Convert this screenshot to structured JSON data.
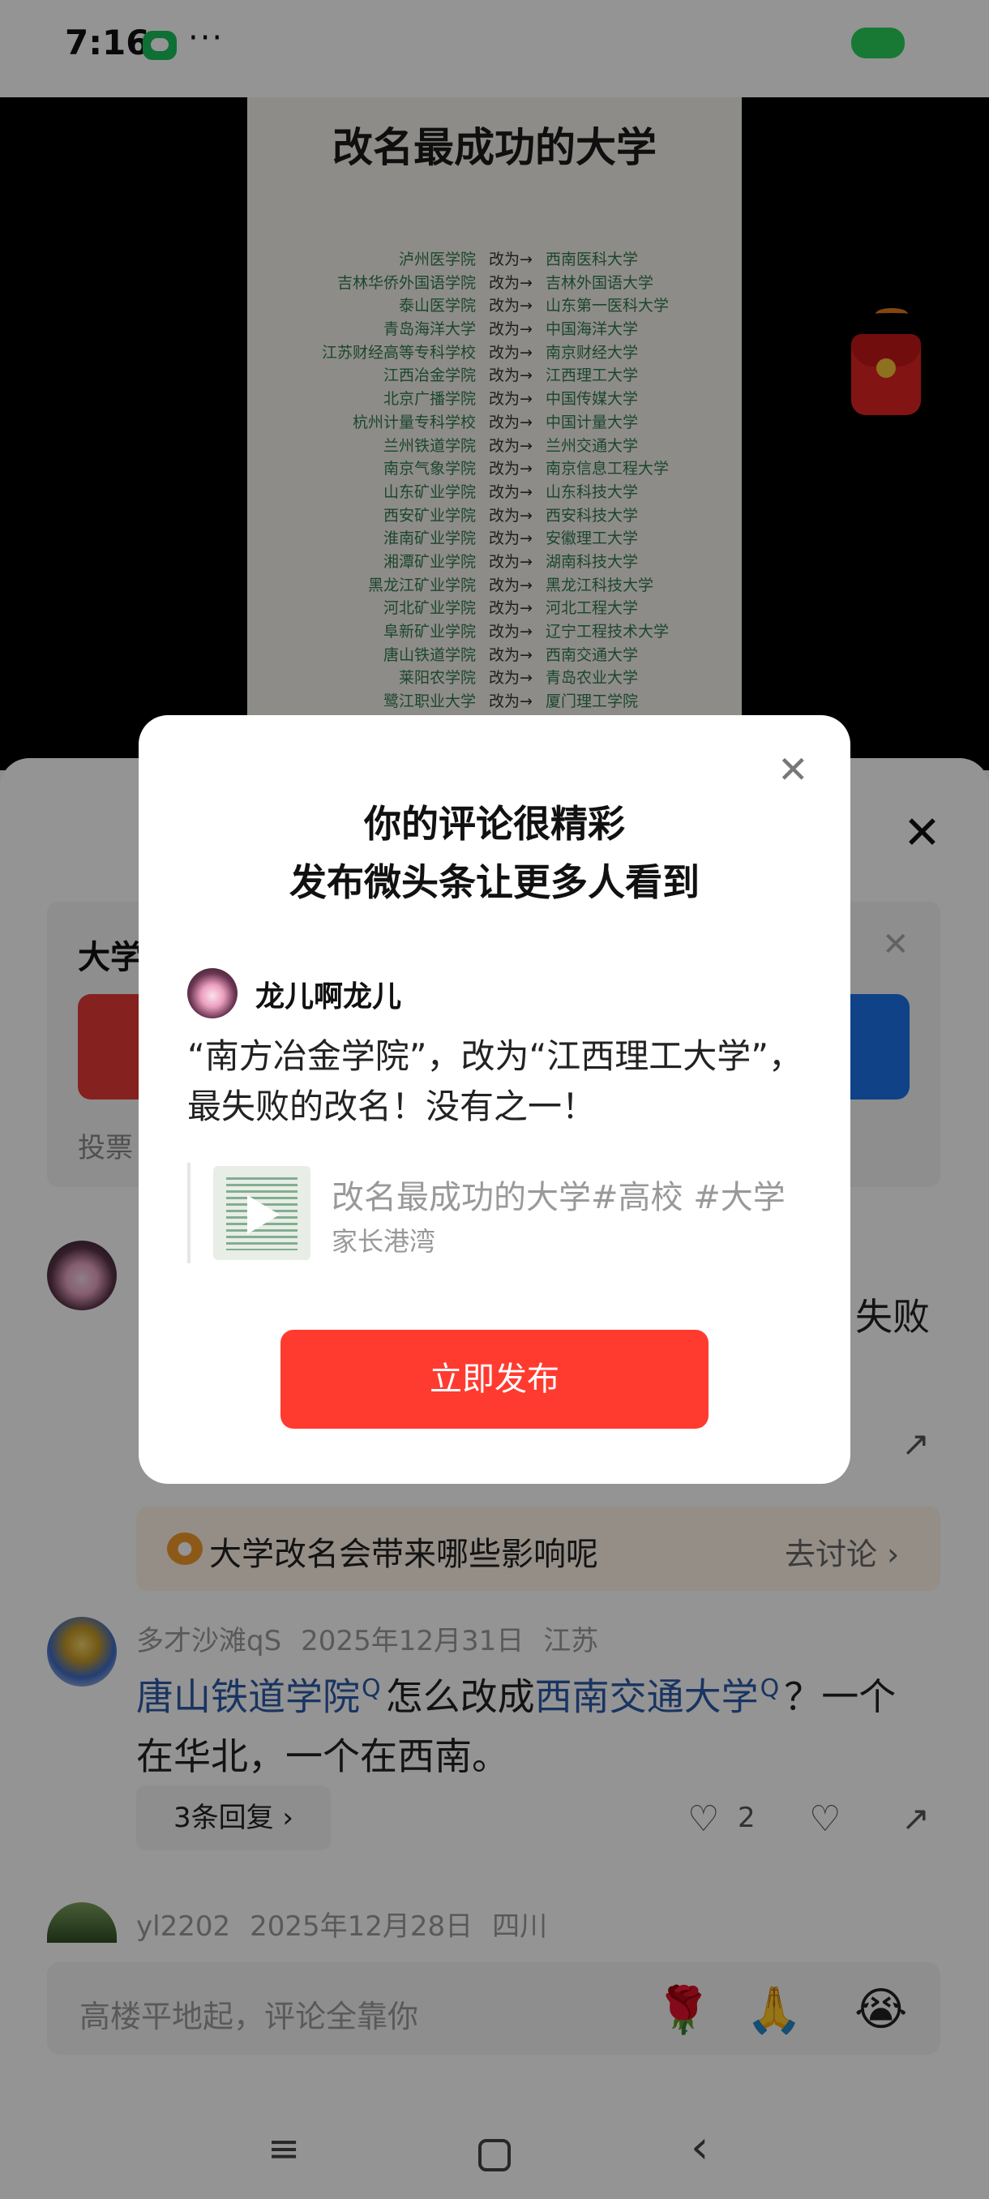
{
  "status_bar": {
    "time": "7:16",
    "more": "···"
  },
  "video": {
    "poster_title": "改名最成功的大学",
    "arrow_text": "改为→",
    "renames": [
      {
        "old": "泸州医学院",
        "new": "西南医科大学"
      },
      {
        "old": "吉林华侨外国语学院",
        "new": "吉林外国语大学"
      },
      {
        "old": "泰山医学院",
        "new": "山东第一医科大学"
      },
      {
        "old": "青岛海洋大学",
        "new": "中国海洋大学"
      },
      {
        "old": "江苏财经高等专科学校",
        "new": "南京财经大学"
      },
      {
        "old": "江西冶金学院",
        "new": "江西理工大学"
      },
      {
        "old": "北京广播学院",
        "new": "中国传媒大学"
      },
      {
        "old": "杭州计量专科学校",
        "new": "中国计量大学"
      },
      {
        "old": "兰州铁道学院",
        "new": "兰州交通大学"
      },
      {
        "old": "南京气象学院",
        "new": "南京信息工程大学"
      },
      {
        "old": "山东矿业学院",
        "new": "山东科技大学"
      },
      {
        "old": "西安矿业学院",
        "new": "西安科技大学"
      },
      {
        "old": "淮南矿业学院",
        "new": "安徽理工大学"
      },
      {
        "old": "湘潭矿业学院",
        "new": "湖南科技大学"
      },
      {
        "old": "黑龙江矿业学院",
        "new": "黑龙江科技大学"
      },
      {
        "old": "河北矿业学院",
        "new": "河北工程大学"
      },
      {
        "old": "阜新矿业学院",
        "new": "辽宁工程技术大学"
      },
      {
        "old": "唐山铁道学院",
        "new": "西南交通大学"
      },
      {
        "old": "莱阳农学院",
        "new": "青岛农业大学"
      },
      {
        "old": "鹭江职业大学",
        "new": "厦门理工学院"
      }
    ]
  },
  "sheet": {
    "close": "✕",
    "vote": {
      "title": "大学",
      "footer": "投票"
    },
    "comment1_tail": "失败",
    "topic": {
      "text": "大学改名会带来哪些影响呢",
      "link": "去讨论 ›"
    },
    "comment2": {
      "user": "多才沙滩qS",
      "date": "2025年12月31日",
      "location": "江苏",
      "link1": "唐山铁道学院",
      "text1": "怎么改成",
      "link2": "西南交通大学",
      "text2": "？一个在华北，一个在西南。",
      "replies": "3条回复 ›",
      "likes": "2"
    },
    "comment3": {
      "user": "yl2202",
      "date": "2025年12月28日",
      "location": "四川"
    },
    "input_placeholder": "高楼平地起，评论全靠你",
    "emojis": [
      "🌹",
      "🙏",
      "😭"
    ]
  },
  "dialog": {
    "close": "✕",
    "title_line1": "你的评论很精彩",
    "title_line2": "发布微头条让更多人看到",
    "user_name": "龙儿啊龙儿",
    "comment": "“南方冶金学院”，改为“江西理工大学”，最失败的改名！没有之一！",
    "quote_title": "改名最成功的大学#高校 #大学",
    "quote_author": "家长港湾",
    "publish_label": "立即发布"
  },
  "icons": {
    "like": "♡",
    "dislike": "♡",
    "share": "↗",
    "search_mark": "Q",
    "nav_menu": "≡",
    "nav_back": "‹"
  }
}
